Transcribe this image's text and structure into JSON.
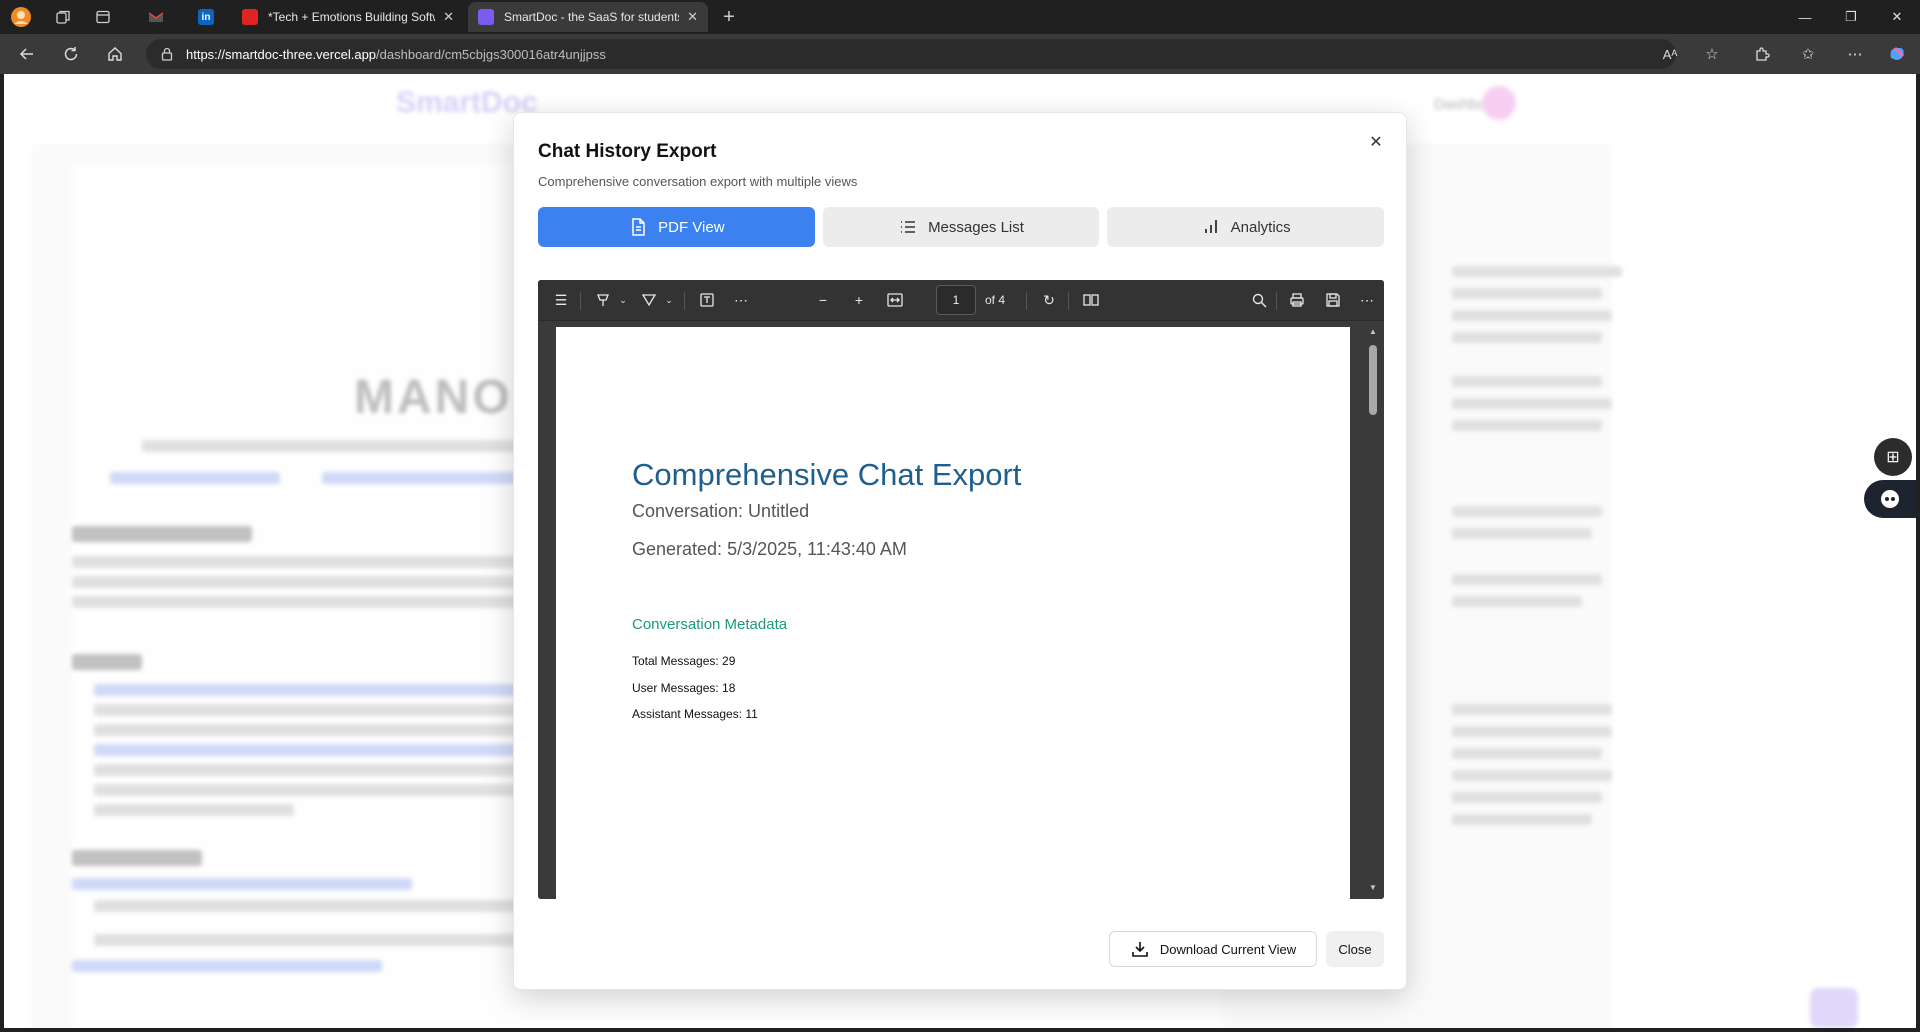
{
  "browser": {
    "tabs": [
      {
        "title": "",
        "kind": "gmail"
      },
      {
        "title": "",
        "kind": "linkedin"
      },
      {
        "title": "*Tech + Emotions Building Software",
        "close": "✕"
      },
      {
        "title": "SmartDoc - the SaaS for students",
        "close": "✕"
      }
    ],
    "new_tab": "+",
    "url_host": "https://smartdoc-three.vercel.app",
    "url_path": "/dashboard/cm5cbjgs300016atr4unjjpss"
  },
  "background_page": {
    "logo": "SmartDoc",
    "dashboard_link": "Dashboard",
    "resume_name": "MANOHA"
  },
  "modal": {
    "title": "Chat History Export",
    "subtitle": "Comprehensive conversation export with multiple views",
    "close_symbol": "✕",
    "tabs": [
      {
        "label": "PDF View",
        "icon": "document-icon",
        "active": true
      },
      {
        "label": "Messages List",
        "icon": "list-icon",
        "active": false
      },
      {
        "label": "Analytics",
        "icon": "bar-chart-icon",
        "active": false
      }
    ],
    "viewer": {
      "page_current": "1",
      "page_total_text": "of 4",
      "pdf": {
        "heading": "Comprehensive Chat Export",
        "conversation": "Conversation: Untitled",
        "generated": "Generated: 5/3/2025, 11:43:40 AM",
        "metadata_heading": "Conversation Metadata",
        "total_messages": "Total Messages: 29",
        "user_messages": "User Messages: 18",
        "assistant_messages": "Assistant Messages: 11"
      }
    },
    "download_label": "Download Current View",
    "close_label": "Close"
  },
  "colors": {
    "accent_blue": "#3b82f0",
    "pdf_heading": "#1f5f8e",
    "pdf_subheading": "#1a9a7d"
  }
}
